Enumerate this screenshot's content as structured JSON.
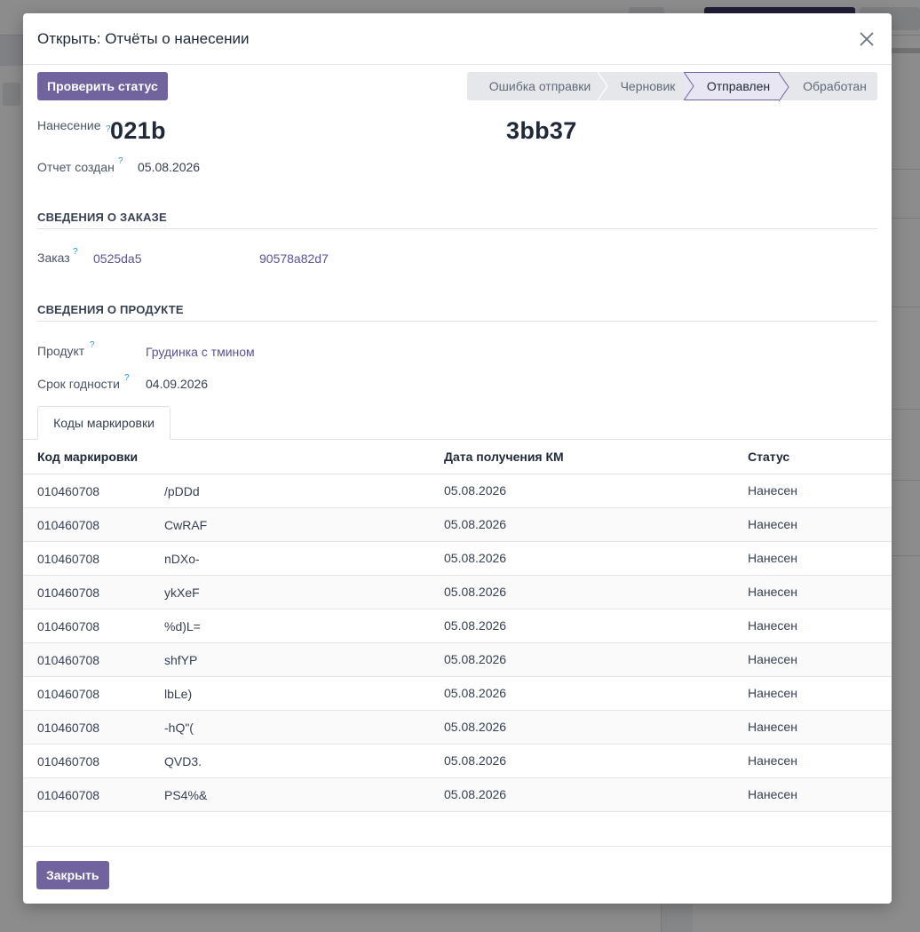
{
  "modal": {
    "title": "Открыть: Отчёты о нанесении",
    "check_status_button": "Проверить статус",
    "stages": [
      {
        "label": "Ошибка отправки",
        "active": false
      },
      {
        "label": "Черновик",
        "active": false
      },
      {
        "label": "Отправлен",
        "active": true
      },
      {
        "label": "Обработан",
        "active": false
      }
    ],
    "fields": {
      "application_label": "Нанесение",
      "application_id_start": "021b",
      "application_id_end": "3bb37",
      "report_created_label": "Отчет создан",
      "report_created_value": "05.08.2026"
    },
    "order_section": {
      "title": "СВЕДЕНИЯ О ЗАКАЗЕ",
      "order_label": "Заказ",
      "order_value_start": "0525da5",
      "order_value_end": "90578a82d7"
    },
    "product_section": {
      "title": "СВЕДЕНИЯ О ПРОДУКТЕ",
      "product_label": "Продукт",
      "product_value": "Грудинка с тмином",
      "expiry_label": "Срок годности",
      "expiry_value": "04.09.2026"
    },
    "tab_label": "Коды маркировки",
    "table": {
      "headers": [
        "Код маркировки",
        "Дата получения КМ",
        "Статус"
      ],
      "rows": [
        {
          "code_start": "010460708",
          "code_end": "/pDDd",
          "date": "05.08.2026",
          "status": "Нанесен"
        },
        {
          "code_start": "010460708",
          "code_end": "CwRAF",
          "date": "05.08.2026",
          "status": "Нанесен"
        },
        {
          "code_start": "010460708",
          "code_end": "nDXo-",
          "date": "05.08.2026",
          "status": "Нанесен"
        },
        {
          "code_start": "010460708",
          "code_end": "ykXeF",
          "date": "05.08.2026",
          "status": "Нанесен"
        },
        {
          "code_start": "010460708",
          "code_end": "%d)L=",
          "date": "05.08.2026",
          "status": "Нанесен"
        },
        {
          "code_start": "010460708",
          "code_end": "shfYP",
          "date": "05.08.2026",
          "status": "Нанесен"
        },
        {
          "code_start": "010460708",
          "code_end": "lbLe)",
          "date": "05.08.2026",
          "status": "Нанесен"
        },
        {
          "code_start": "010460708",
          "code_end": "-hQ\"(",
          "date": "05.08.2026",
          "status": "Нанесен"
        },
        {
          "code_start": "010460708",
          "code_end": "QVD3.",
          "date": "05.08.2026",
          "status": "Нанесен"
        },
        {
          "code_start": "010460708",
          "code_end": "PS4%&",
          "date": "05.08.2026",
          "status": "Нанесен"
        }
      ]
    },
    "close_button": "Закрыть"
  },
  "colors": {
    "primary": "#71639e",
    "active_stage_bg": "#e9e6f3",
    "link": "#5b5291"
  },
  "icons": {
    "close": "close-icon",
    "help": "help-icon"
  }
}
